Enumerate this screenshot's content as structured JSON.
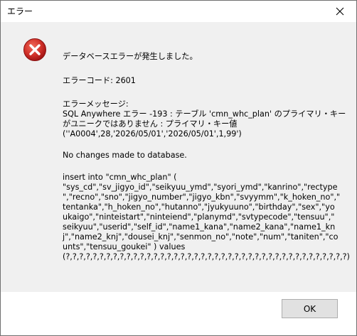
{
  "window": {
    "title": "エラー",
    "close_icon": "close-icon"
  },
  "icon": "error-icon",
  "message": {
    "header": "データベースエラーが発生しました。",
    "error_code": "エラーコード: 2601",
    "error_message_label": "エラーメッセージ:",
    "error_lines": [
      "SQL Anywhere エラー -193 : テーブル 'cmn_whc_plan' のプライマリ・キー",
      "がユニークではありません : プライマリ・キー値",
      "(''A0004',28,'2026/05/01','2026/05/01',1,99')"
    ],
    "no_changes": "No changes made to database.",
    "insert_lines": [
      "insert into \"cmn_whc_plan\" (",
      "\"sys_cd\",\"sv_jigyo_id\",\"seikyuu_ymd\",\"syori_ymd\",\"kanrino\",\"rectype",
      "\",\"recno\",\"sno\",\"jigyo_number\",\"jigyo_kbn\",\"svyymm\",\"k_hoken_no\",\"",
      "tentanka\",\"h_hoken_no\",\"hutanno\",\"jyukyuuno\",\"birthday\",\"sex\",\"yo",
      "ukaigo\",\"ninteistart\",\"ninteiend\",\"planymd\",\"svtypecode\",\"tensuu\",\"",
      "seikyuu\",\"userid\",\"self_id\",\"name1_kana\",\"name2_kana\",\"name1_kn",
      "j\",\"name2_knj\",\"dousei_knj\",\"senmon_no\",\"note\",\"num\",\"taniten\",\"co",
      "unts\",\"tensuu_goukei\" )  values",
      "(?,?,?,?,?,?,?,?,?,?,?,?,?,?,?,?,?,?,?,?,?,?,?,?,?,?,?,?,?,?,?,?,?,?,?,?,?,?,?,?,?,?)"
    ]
  },
  "buttons": {
    "ok_label": "OK"
  },
  "colors": {
    "error_red": "#c62828",
    "content_bg": "#f0f0f0"
  }
}
